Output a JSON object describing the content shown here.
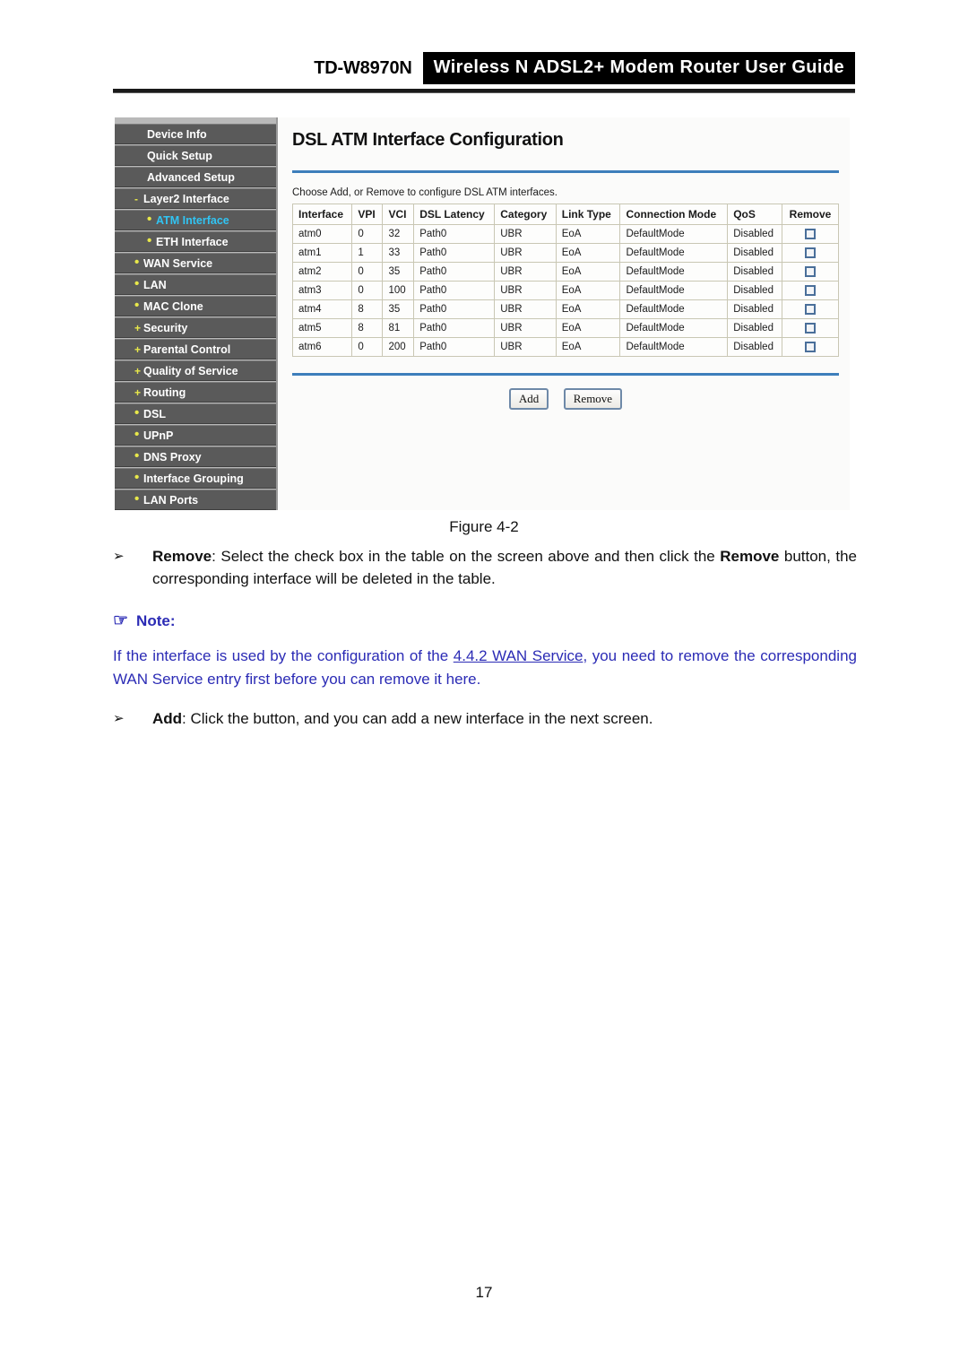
{
  "header": {
    "model": "TD-W8970N",
    "band_title": "Wireless N ADSL2+ Modem Router User Guide"
  },
  "ui_screenshot": {
    "sidebar": {
      "items": [
        {
          "label": "Device Info",
          "marker": "",
          "level": 0,
          "active": false
        },
        {
          "label": "Quick Setup",
          "marker": "",
          "level": 0,
          "active": false
        },
        {
          "label": "Advanced Setup",
          "marker": "",
          "level": 0,
          "active": false
        },
        {
          "label": "Layer2 Interface",
          "marker": "-",
          "level": 1,
          "active": false
        },
        {
          "label": "ATM Interface",
          "marker": "•",
          "level": 2,
          "active": true
        },
        {
          "label": "ETH Interface",
          "marker": "•",
          "level": 2,
          "active": false
        },
        {
          "label": "WAN Service",
          "marker": "•",
          "level": 1,
          "active": false
        },
        {
          "label": "LAN",
          "marker": "•",
          "level": 1,
          "active": false
        },
        {
          "label": "MAC Clone",
          "marker": "•",
          "level": 1,
          "active": false
        },
        {
          "label": "Security",
          "marker": "+",
          "level": 1,
          "active": false
        },
        {
          "label": "Parental Control",
          "marker": "+",
          "level": 1,
          "active": false
        },
        {
          "label": "Quality of Service",
          "marker": "+",
          "level": 1,
          "active": false
        },
        {
          "label": "Routing",
          "marker": "+",
          "level": 1,
          "active": false
        },
        {
          "label": "DSL",
          "marker": "•",
          "level": 1,
          "active": false
        },
        {
          "label": "UPnP",
          "marker": "•",
          "level": 1,
          "active": false
        },
        {
          "label": "DNS Proxy",
          "marker": "•",
          "level": 1,
          "active": false
        },
        {
          "label": "Interface Grouping",
          "marker": "•",
          "level": 1,
          "active": false
        },
        {
          "label": "LAN Ports",
          "marker": "•",
          "level": 1,
          "active": false
        }
      ]
    },
    "main": {
      "title": "DSL ATM Interface Configuration",
      "description": "Choose Add, or Remove to configure DSL ATM interfaces.",
      "table": {
        "columns": [
          "Interface",
          "VPI",
          "VCI",
          "DSL Latency",
          "Category",
          "Link Type",
          "Connection Mode",
          "QoS",
          "Remove"
        ],
        "rows": [
          {
            "interface": "atm0",
            "vpi": "0",
            "vci": "32",
            "latency": "Path0",
            "category": "UBR",
            "link_type": "EoA",
            "connection_mode": "DefaultMode",
            "qos": "Disabled",
            "remove_checked": false
          },
          {
            "interface": "atm1",
            "vpi": "1",
            "vci": "33",
            "latency": "Path0",
            "category": "UBR",
            "link_type": "EoA",
            "connection_mode": "DefaultMode",
            "qos": "Disabled",
            "remove_checked": false
          },
          {
            "interface": "atm2",
            "vpi": "0",
            "vci": "35",
            "latency": "Path0",
            "category": "UBR",
            "link_type": "EoA",
            "connection_mode": "DefaultMode",
            "qos": "Disabled",
            "remove_checked": false
          },
          {
            "interface": "atm3",
            "vpi": "0",
            "vci": "100",
            "latency": "Path0",
            "category": "UBR",
            "link_type": "EoA",
            "connection_mode": "DefaultMode",
            "qos": "Disabled",
            "remove_checked": false
          },
          {
            "interface": "atm4",
            "vpi": "8",
            "vci": "35",
            "latency": "Path0",
            "category": "UBR",
            "link_type": "EoA",
            "connection_mode": "DefaultMode",
            "qos": "Disabled",
            "remove_checked": false
          },
          {
            "interface": "atm5",
            "vpi": "8",
            "vci": "81",
            "latency": "Path0",
            "category": "UBR",
            "link_type": "EoA",
            "connection_mode": "DefaultMode",
            "qos": "Disabled",
            "remove_checked": false
          },
          {
            "interface": "atm6",
            "vpi": "0",
            "vci": "200",
            "latency": "Path0",
            "category": "UBR",
            "link_type": "EoA",
            "connection_mode": "DefaultMode",
            "qos": "Disabled",
            "remove_checked": false
          }
        ]
      },
      "buttons": {
        "add": "Add",
        "remove": "Remove"
      }
    }
  },
  "figure": {
    "caption": "Figure 4-2"
  },
  "body": {
    "bullet_marker": "➢",
    "remove_item": {
      "term": "Remove",
      "text_before_bold": ": Select the check box in the table on the screen above and then click the ",
      "bold_word": "Remove",
      "text_after_bold": " button, the corresponding interface will be deleted in the table."
    },
    "note": {
      "icon": "☞",
      "heading": "Note:",
      "text_before_link": "If the interface is used by the configuration of the ",
      "link_text": "4.4.2 WAN Service",
      "text_after_link": ", you need to remove the corresponding WAN Service entry first before you can remove it here."
    },
    "add_item": {
      "term": "Add",
      "text": ": Click the button, and you can add a new interface in the next screen."
    }
  },
  "page_number": "17",
  "colors": {
    "accent_blue": "#3d7ebb",
    "note_blue": "#2b2bb5",
    "active_nav": "#31c4f3",
    "nav_marker": "#e8e84a",
    "nav_bg": "#5a5a5a"
  }
}
